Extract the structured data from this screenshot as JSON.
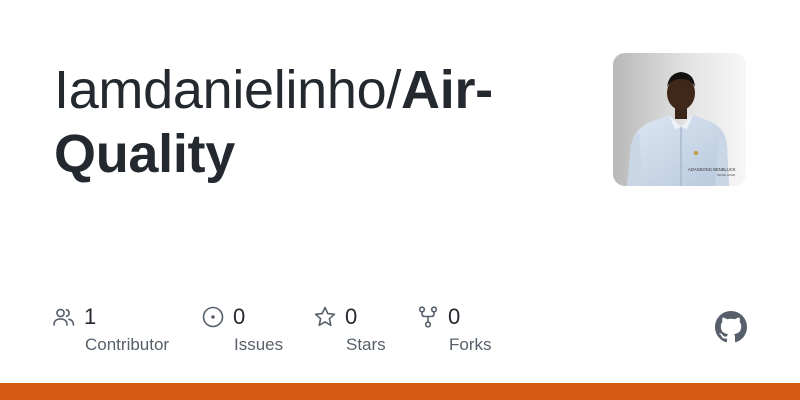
{
  "repo": {
    "owner": "Iamdanielinho/",
    "name": "Air-Quality"
  },
  "avatar": {
    "alt": "owner avatar",
    "badge_line1": "ADANSONG BENBLUCK",
    "badge_line2": "DEVELOPER"
  },
  "stats": [
    {
      "icon": "people-icon",
      "value": "1",
      "label": "Contributor"
    },
    {
      "icon": "issue-icon",
      "value": "0",
      "label": "Issues"
    },
    {
      "icon": "star-icon",
      "value": "0",
      "label": "Stars"
    },
    {
      "icon": "fork-icon",
      "value": "0",
      "label": "Forks"
    }
  ],
  "colors": {
    "text": "#24292f",
    "muted": "#57606a",
    "bar": "#d55c12",
    "logo": "#57606a"
  },
  "logo": {
    "icon": "github-logo-icon"
  }
}
